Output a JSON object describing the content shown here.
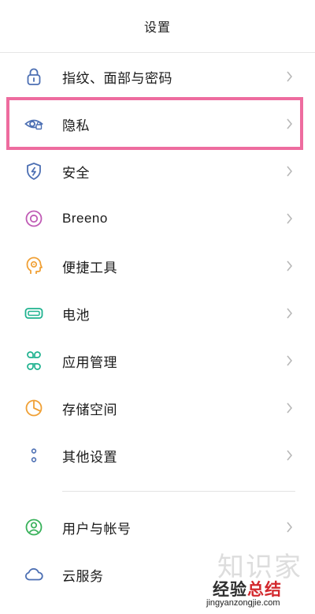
{
  "header": {
    "title": "设置"
  },
  "items": [
    {
      "label": "指纹、面部与密码",
      "icon": "lock-icon"
    },
    {
      "label": "隐私",
      "icon": "privacy-eye-icon"
    },
    {
      "label": "安全",
      "icon": "shield-lightning-icon"
    },
    {
      "label": "Breeno",
      "icon": "breeno-icon"
    },
    {
      "label": "便捷工具",
      "icon": "head-gear-icon"
    },
    {
      "label": "电池",
      "icon": "battery-icon"
    },
    {
      "label": "应用管理",
      "icon": "apps-grid-icon"
    },
    {
      "label": "存储空间",
      "icon": "storage-pie-icon"
    },
    {
      "label": "其他设置",
      "icon": "more-dots-icon"
    },
    {
      "label": "用户与帐号",
      "icon": "user-icon"
    },
    {
      "label": "云服务",
      "icon": "cloud-icon"
    }
  ],
  "colors": {
    "highlight": "#ee6c9f",
    "icon_blue": "#4c6fb3",
    "icon_pink": "#c05bb5",
    "icon_orange": "#f0a035",
    "icon_teal": "#1fb28f",
    "icon_green": "#38b15a"
  },
  "watermark": {
    "top_text": "知识家",
    "chinese_left": "经验",
    "chinese_right": "总结",
    "url": "jingyanzongjie.com"
  }
}
